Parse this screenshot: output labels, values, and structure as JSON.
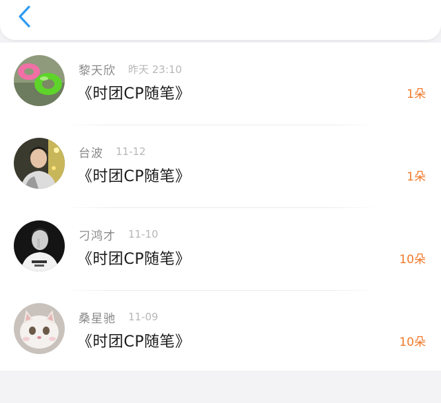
{
  "header": {
    "back_icon": "chevron-left-icon",
    "accent_color": "#2f9bf2"
  },
  "items": [
    {
      "username": "黎天欣",
      "time": "昨天 23:10",
      "title": "《时团CP随笔》",
      "flowers": "1朵",
      "avatar": "inflatable-rings"
    },
    {
      "username": "台波",
      "time": "11-12",
      "title": "《时团CP随笔》",
      "flowers": "1朵",
      "avatar": "young-man-photo"
    },
    {
      "username": "刁鸿才",
      "time": "11-10",
      "title": "《时团CP随笔》",
      "flowers": "10朵",
      "avatar": "black-white-portrait"
    },
    {
      "username": "桑星驰",
      "time": "11-09",
      "title": "《时团CP随笔》",
      "flowers": "10朵",
      "avatar": "white-cat"
    }
  ],
  "colors": {
    "flower_count": "#f07a2c",
    "username": "#8a8a8a",
    "time": "#b7b7b7"
  }
}
